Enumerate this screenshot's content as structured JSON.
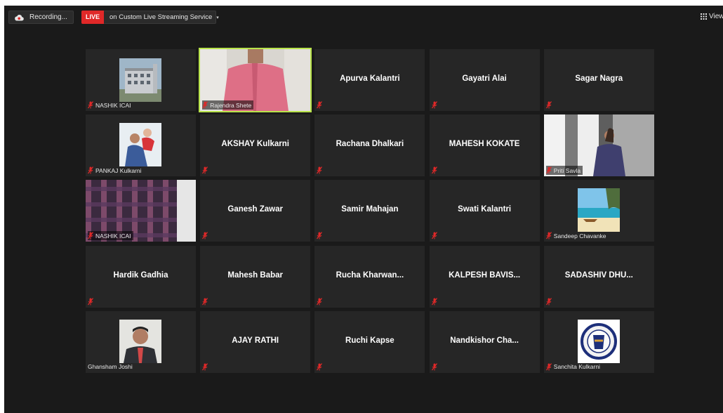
{
  "topbar": {
    "recording_label": "Recording...",
    "live_badge": "LIVE",
    "live_text": "on Custom Live Streaming Service",
    "caret": "▾",
    "view_label": "View"
  },
  "colors": {
    "live": "#e02828",
    "active_speaker": "#b8e34a",
    "muted_mic": "#e02828"
  },
  "tiles": [
    {
      "name": "",
      "label": "NASHIK ICAI",
      "media": "building-photo"
    },
    {
      "name": "",
      "label": "Rajendra Shete",
      "media": "person-video",
      "active": true
    },
    {
      "name": "Apurva Kalantri",
      "label": ""
    },
    {
      "name": "Gayatri Alai",
      "label": ""
    },
    {
      "name": "Sagar Nagra",
      "label": ""
    },
    {
      "name": "",
      "label": "PANKAJ Kulkarni",
      "media": "family-photo"
    },
    {
      "name": "AKSHAY Kulkarni",
      "label": ""
    },
    {
      "name": "Rachana Dhalkari",
      "label": ""
    },
    {
      "name": "MAHESH KOKATE",
      "label": ""
    },
    {
      "name": "",
      "label": "Priti Savla",
      "media": "woman-video"
    },
    {
      "name": "",
      "label": "NASHIK ICAI",
      "media": "shirt-video"
    },
    {
      "name": "Ganesh Zawar",
      "label": ""
    },
    {
      "name": "Samir Mahajan",
      "label": ""
    },
    {
      "name": "Swati Kalantri",
      "label": ""
    },
    {
      "name": "",
      "label": "Sandeep Chavanke",
      "media": "beach-photo"
    },
    {
      "name": "Hardik Gadhia",
      "label": ""
    },
    {
      "name": "Mahesh Babar",
      "label": ""
    },
    {
      "name": "Rucha  Kharwan...",
      "label": ""
    },
    {
      "name": "KALPESH  BAVIS...",
      "label": ""
    },
    {
      "name": "SADASHIV  DHU...",
      "label": ""
    },
    {
      "name": "",
      "label": "Ghansham Joshi",
      "media": "portrait-photo"
    },
    {
      "name": "AJAY RATHI",
      "label": ""
    },
    {
      "name": "Ruchi Kapse",
      "label": ""
    },
    {
      "name": "Nandkishor  Cha...",
      "label": ""
    },
    {
      "name": "",
      "label": "Sanchita Kulkarni",
      "media": "icai-logo"
    }
  ]
}
